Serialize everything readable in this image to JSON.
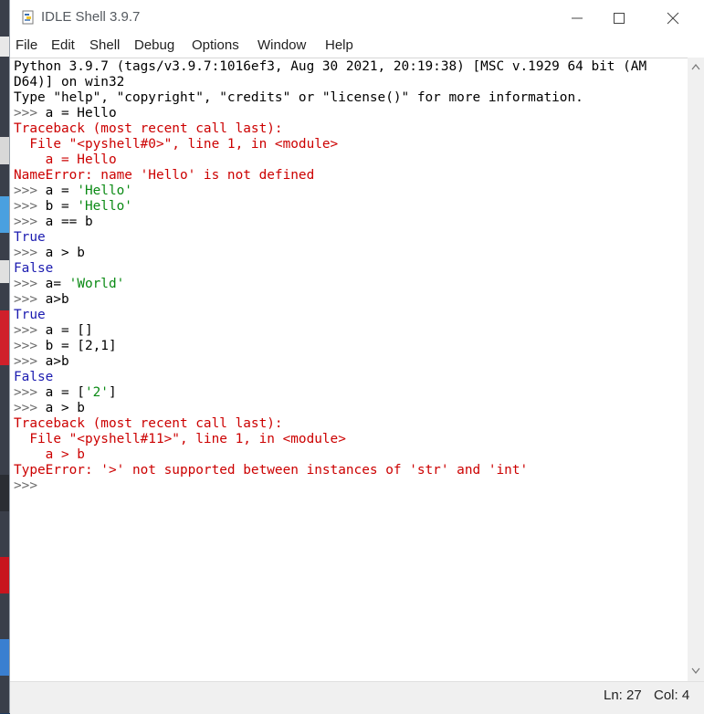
{
  "window": {
    "title": "IDLE Shell 3.9.7"
  },
  "menu": [
    "File",
    "Edit",
    "Shell",
    "Debug",
    "Options",
    "Window",
    "Help"
  ],
  "shell": {
    "lines": [
      [
        {
          "t": "Python 3.9.7 (tags/v3.9.7:1016ef3, Aug 30 2021, 20:19:38) [MSC v.1929 64 bit (AM",
          "k": "out"
        }
      ],
      [
        {
          "t": "D64)] on win32",
          "k": "out"
        }
      ],
      [
        {
          "t": "Type \"help\", \"copyright\", \"credits\" or \"license()\" for more information.",
          "k": "out"
        }
      ],
      [
        {
          "t": ">>> ",
          "k": "prompt"
        },
        {
          "t": "a = Hello",
          "k": "out"
        }
      ],
      [
        {
          "t": "Traceback (most recent call last):",
          "k": "err"
        }
      ],
      [
        {
          "t": "  File \"<pyshell#0>\", line 1, in <module>",
          "k": "err"
        }
      ],
      [
        {
          "t": "    a = Hello",
          "k": "err"
        }
      ],
      [
        {
          "t": "NameError: name 'Hello' is not defined",
          "k": "err"
        }
      ],
      [
        {
          "t": ">>> ",
          "k": "prompt"
        },
        {
          "t": "a = ",
          "k": "out"
        },
        {
          "t": "'Hello'",
          "k": "str"
        }
      ],
      [
        {
          "t": ">>> ",
          "k": "prompt"
        },
        {
          "t": "b = ",
          "k": "out"
        },
        {
          "t": "'Hello'",
          "k": "str"
        }
      ],
      [
        {
          "t": ">>> ",
          "k": "prompt"
        },
        {
          "t": "a == b",
          "k": "out"
        }
      ],
      [
        {
          "t": "True",
          "k": "res"
        }
      ],
      [
        {
          "t": ">>> ",
          "k": "prompt"
        },
        {
          "t": "a > b",
          "k": "out"
        }
      ],
      [
        {
          "t": "False",
          "k": "res"
        }
      ],
      [
        {
          "t": ">>> ",
          "k": "prompt"
        },
        {
          "t": "a= ",
          "k": "out"
        },
        {
          "t": "'World'",
          "k": "str"
        }
      ],
      [
        {
          "t": ">>> ",
          "k": "prompt"
        },
        {
          "t": "a>b",
          "k": "out"
        }
      ],
      [
        {
          "t": "True",
          "k": "res"
        }
      ],
      [
        {
          "t": ">>> ",
          "k": "prompt"
        },
        {
          "t": "a = []",
          "k": "out"
        }
      ],
      [
        {
          "t": ">>> ",
          "k": "prompt"
        },
        {
          "t": "b = [2,1]",
          "k": "out"
        }
      ],
      [
        {
          "t": ">>> ",
          "k": "prompt"
        },
        {
          "t": "a>b",
          "k": "out"
        }
      ],
      [
        {
          "t": "False",
          "k": "res"
        }
      ],
      [
        {
          "t": ">>> ",
          "k": "prompt"
        },
        {
          "t": "a = [",
          "k": "out"
        },
        {
          "t": "'2'",
          "k": "str"
        },
        {
          "t": "]",
          "k": "out"
        }
      ],
      [
        {
          "t": ">>> ",
          "k": "prompt"
        },
        {
          "t": "a > b",
          "k": "out"
        }
      ],
      [
        {
          "t": "Traceback (most recent call last):",
          "k": "err"
        }
      ],
      [
        {
          "t": "  File \"<pyshell#11>\", line 1, in <module>",
          "k": "err"
        }
      ],
      [
        {
          "t": "    a > b",
          "k": "err"
        }
      ],
      [
        {
          "t": "TypeError: '>' not supported between instances of 'str' and 'int'",
          "k": "err"
        }
      ],
      [
        {
          "t": ">>> ",
          "k": "prompt"
        }
      ]
    ]
  },
  "status": {
    "line": "Ln: 27",
    "col": "Col: 4"
  },
  "colors": {
    "prompt": "#6b6b6b",
    "output": "#000000",
    "string": "#0a8a14",
    "error": "#cc0000",
    "result": "#1b1bb0"
  },
  "icons": {
    "app": "idle-python-icon",
    "minimize": "minimize-icon",
    "maximize": "maximize-icon",
    "close": "close-icon"
  }
}
